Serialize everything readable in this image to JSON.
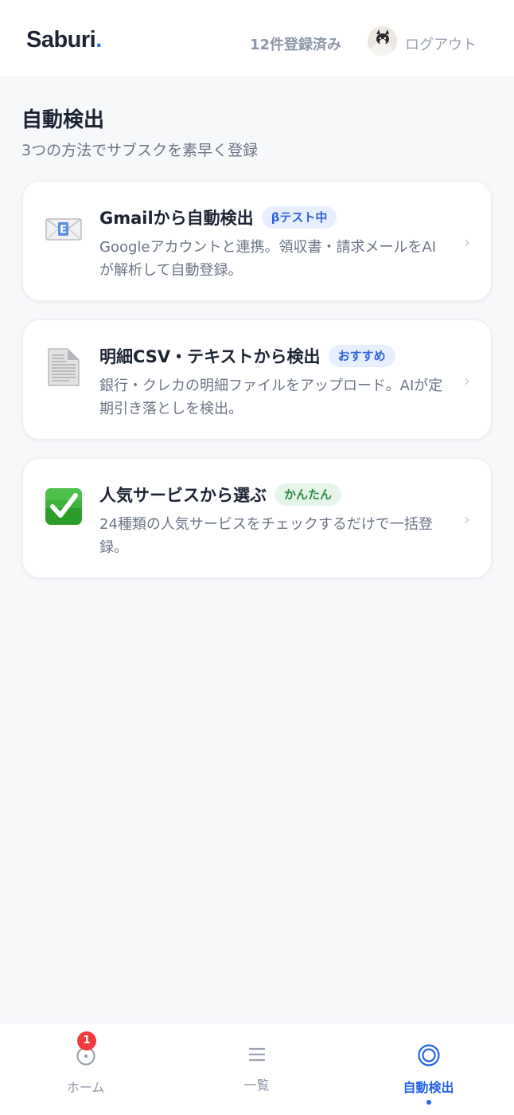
{
  "header": {
    "logo_text": "Saburi",
    "logo_dot": ".",
    "registered_count": "12件登録済み",
    "logout_label": "ログアウト"
  },
  "page": {
    "title": "自動検出",
    "subtitle": "3つの方法でサブスクを素早く登録"
  },
  "methods": [
    {
      "icon": "envelope-icon",
      "title": "Gmailから自動検出",
      "badge": "βテスト中",
      "description": "Googleアカウントと連携。領収書・請求メールをAIが解析して自動登録。"
    },
    {
      "icon": "document-icon",
      "title": "明細CSV・テキストから検出",
      "badge": "おすすめ",
      "description": "銀行・クレカの明細ファイルをアップロード。AIが定期引き落としを検出。"
    },
    {
      "icon": "check-mark-button-icon",
      "title": "人気サービスから選ぶ",
      "badge": "かんたん",
      "description": "24種類の人気サービスをチェックするだけで一括登録。"
    }
  ],
  "chevron": "›",
  "bottom_nav": {
    "items": [
      {
        "label": "ホーム",
        "icon": "home-icon",
        "badge": "1",
        "active": false
      },
      {
        "label": "一覧",
        "icon": "list-icon",
        "active": false
      },
      {
        "label": "自動検出",
        "icon": "detect-icon",
        "active": true
      }
    ]
  },
  "colors": {
    "accent": "#2563eb",
    "badge_red": "#ef3b3b",
    "badge_blue_bg": "#e7efff",
    "badge_green_bg": "#e5f5e9"
  }
}
